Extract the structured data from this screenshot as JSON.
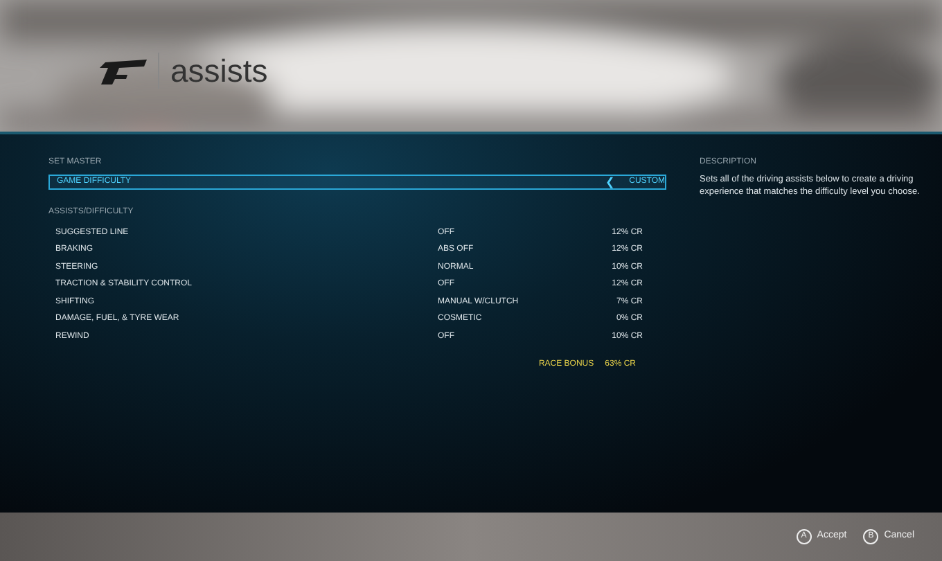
{
  "title": "assists",
  "set_master": {
    "heading": "SET MASTER",
    "label": "GAME DIFFICULTY",
    "value": "CUSTOM",
    "arrow": "❮",
    "selected": true
  },
  "assists": {
    "heading": "ASSISTS/DIFFICULTY",
    "rows": [
      {
        "label": "SUGGESTED LINE",
        "value": "OFF",
        "bonus": "12% CR"
      },
      {
        "label": "BRAKING",
        "value": "ABS OFF",
        "bonus": "12% CR"
      },
      {
        "label": "STEERING",
        "value": "NORMAL",
        "bonus": "10% CR"
      },
      {
        "label": "TRACTION & STABILITY CONTROL",
        "value": "OFF",
        "bonus": "12% CR"
      },
      {
        "label": "SHIFTING",
        "value": "MANUAL W/CLUTCH",
        "bonus": "7% CR"
      },
      {
        "label": "DAMAGE, FUEL, & TYRE WEAR",
        "value": "COSMETIC",
        "bonus": "0% CR"
      },
      {
        "label": "REWIND",
        "value": "OFF",
        "bonus": "10% CR"
      }
    ]
  },
  "race_bonus": {
    "label": "RACE BONUS",
    "value": "63% CR"
  },
  "description": {
    "heading": "DESCRIPTION",
    "text": "Sets all of the driving assists below to create a driving experience that matches the difficulty level you choose."
  },
  "buttons": [
    {
      "key": "A",
      "label": "Accept"
    },
    {
      "key": "B",
      "label": "Cancel"
    }
  ]
}
